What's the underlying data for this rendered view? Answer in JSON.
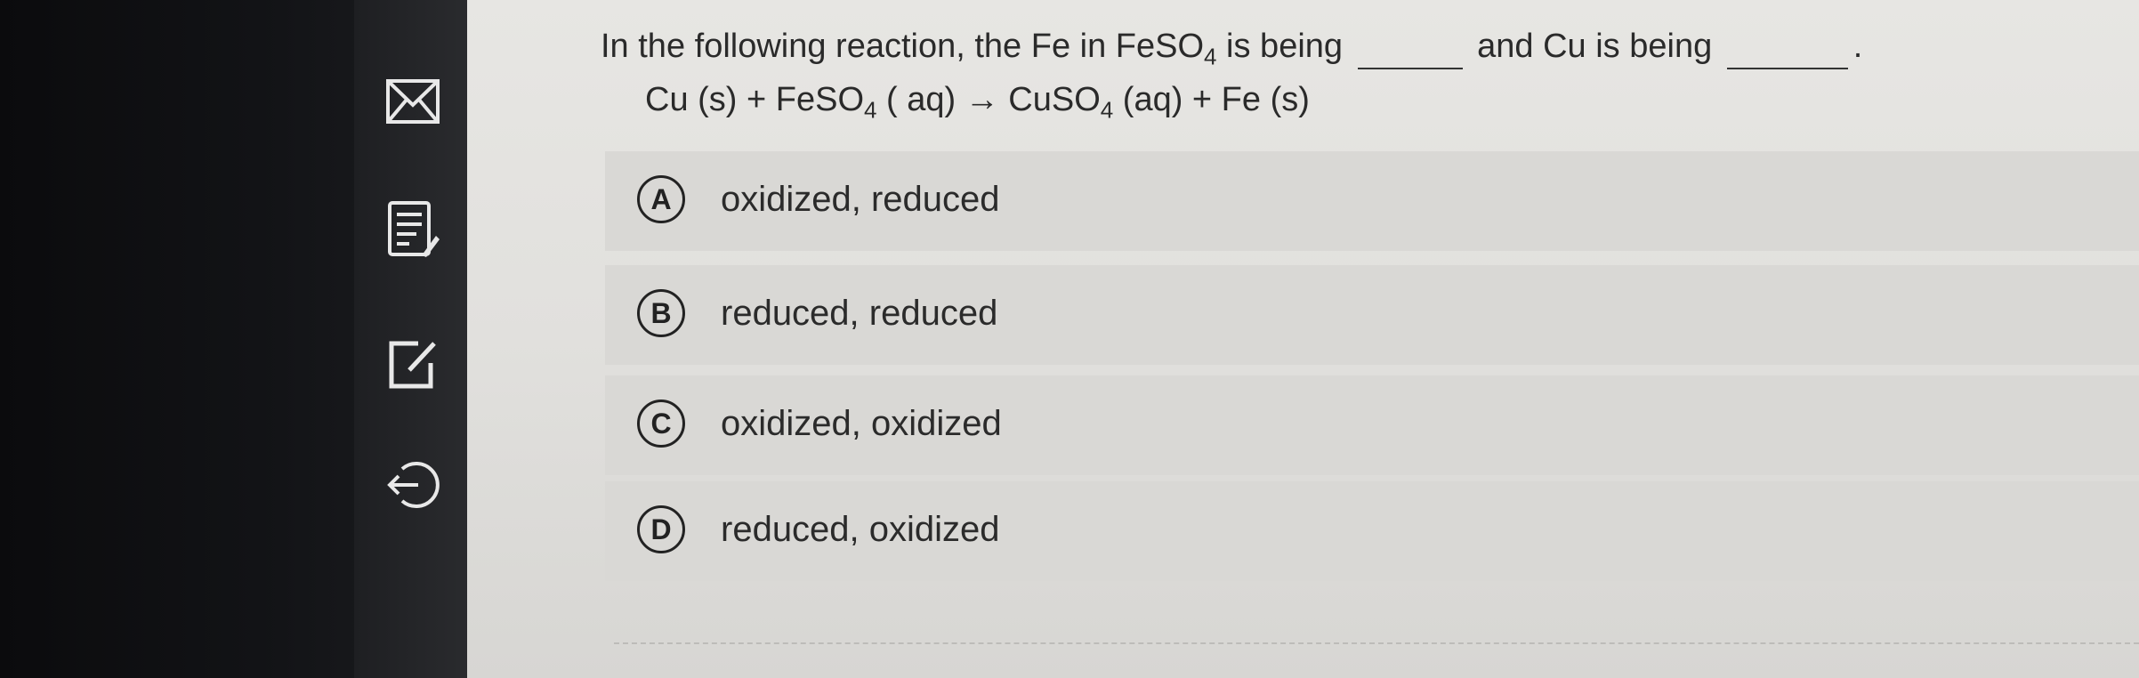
{
  "sidebar": {
    "icons": [
      "mail-icon",
      "notes-icon",
      "edit-icon",
      "logout-icon"
    ]
  },
  "question": {
    "part1": "In the following reaction, the Fe in FeSO",
    "sub1": "4",
    "part2": " is being ",
    "part3": " and Cu is being ",
    "part4": "."
  },
  "equation": {
    "t1": "Cu (s) + FeSO",
    "s1": "4",
    "t2": " ( aq) → CuSO",
    "s2": "4",
    "t3": " (aq) + Fe (s)"
  },
  "options": [
    {
      "letter": "A",
      "text": "oxidized, reduced"
    },
    {
      "letter": "B",
      "text": "reduced, reduced"
    },
    {
      "letter": "C",
      "text": "oxidized, oxidized"
    },
    {
      "letter": "D",
      "text": "reduced, oxidized"
    }
  ]
}
